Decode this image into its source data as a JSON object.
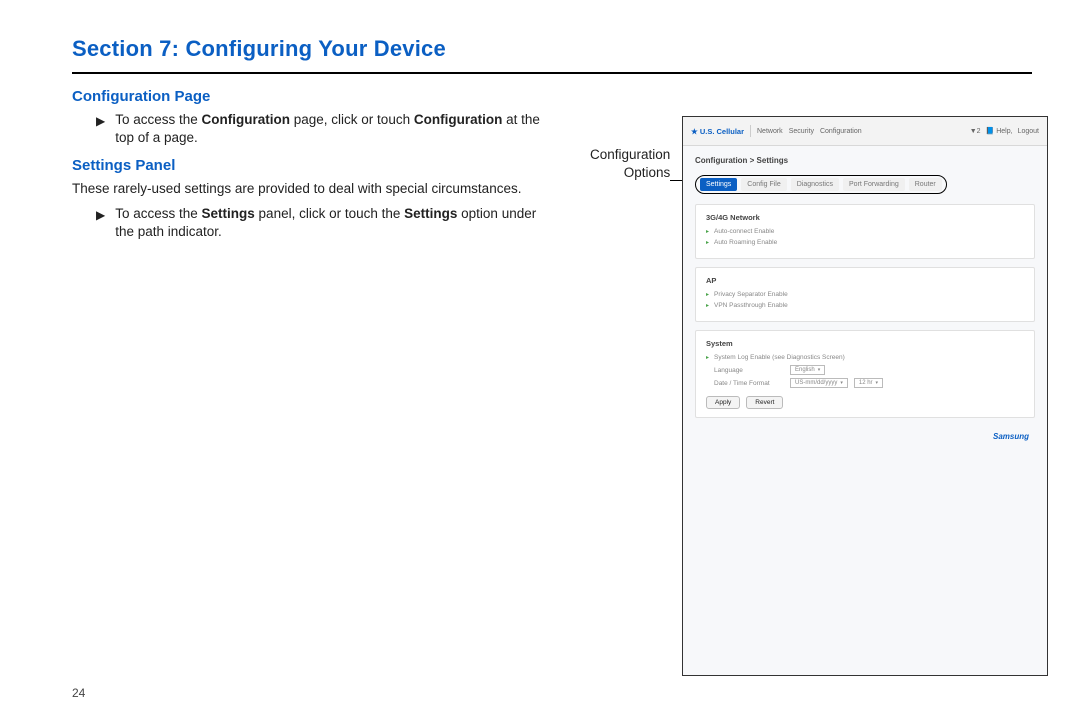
{
  "section_title": "Section 7: Configuring Your Device",
  "subhead1": "Configuration Page",
  "bullet1_pre": "To access the ",
  "bullet1_b1": "Configuration",
  "bullet1_mid": " page, click or touch ",
  "bullet1_b2": "Configuration",
  "bullet1_post": " at the top of a page.",
  "subhead2": "Settings Panel",
  "para2": "These rarely-used settings are provided to deal with special circumstances.",
  "bullet2_pre": "To access the ",
  "bullet2_b1": "Settings",
  "bullet2_mid": " panel, click or touch the ",
  "bullet2_b2": "Settings",
  "bullet2_post": " option under the path indicator.",
  "callout_line1": "Configuration",
  "callout_line2": "Options",
  "page_number": "24",
  "shot": {
    "carrier": "U.S. Cellular",
    "nav": {
      "network": "Network",
      "security": "Security",
      "configuration": "Configuration"
    },
    "signal": "▼2",
    "help": "Help,",
    "logout": "Logout",
    "breadcrumb": "Configuration > Settings",
    "tabs": {
      "settings": "Settings",
      "configfile": "Config File",
      "diagnostics": "Diagnostics",
      "portfwd": "Port Forwarding",
      "router": "Router"
    },
    "sec1_title": "3G/4G Network",
    "sec1_opt1": "Auto-connect Enable",
    "sec1_opt2": "Auto Roaming Enable",
    "sec2_title": "AP",
    "sec2_opt1": "Privacy Separator Enable",
    "sec2_opt2": "VPN Passthrough Enable",
    "sec3_title": "System",
    "sec3_opt1": "System Log Enable (see Diagnostics Screen)",
    "lang_label": "Language",
    "lang_value": "English",
    "dt_label": "Date / Time Format",
    "dt_value": "US-mm/dd/yyyy",
    "dt_value2": "12 hr",
    "btn_apply": "Apply",
    "btn_revert": "Revert",
    "brand": "Samsung"
  }
}
